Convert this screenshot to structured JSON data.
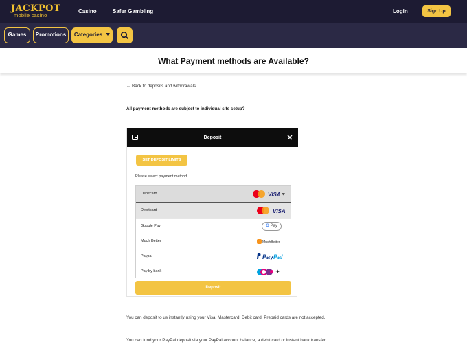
{
  "topbar": {
    "logo_main": "JACKPOT",
    "logo_sub": "mobile casino",
    "links": [
      "Casino",
      "Safer Gambling"
    ],
    "login": "Login",
    "signup": "Sign Up"
  },
  "subnav": {
    "games": "Games",
    "promotions": "Promotions",
    "categories": "Categories"
  },
  "page": {
    "title": "What Payment methods are Available?",
    "back_link": "← Back to deposits and withdrawals",
    "note": "All payment methods are subject to individual site setup?"
  },
  "deposit_modal": {
    "title": "Deposit",
    "limits_button": "SET DEPOSIT LIMITS",
    "select_label": "Please select payment method",
    "selected": "Debitcard",
    "options": [
      "Debitcard",
      "Google Pay",
      "Much Better",
      "Paypal",
      "Pay by bank"
    ],
    "badges": {
      "visa": "VISA",
      "gpay_g": "G",
      "gpay_pay": "Pay",
      "muchbetter": "MuchBetter",
      "paypal_a": "Pay",
      "paypal_b": "Pal"
    },
    "deposit_button": "Deposit"
  },
  "body_text": [
    "You can deposit to us instantly using your Visa, Mastercard, Debit card. Prepaid cards are not accepted.",
    "You can fund your PayPal deposit via your PayPal account balance, a debit card or instant bank transfer."
  ],
  "colors": {
    "nav_dark": "#1d1b33",
    "subnav": "#2b2945",
    "accent": "#f3c443"
  }
}
